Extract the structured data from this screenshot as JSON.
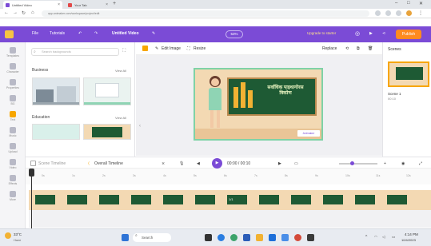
{
  "browser": {
    "tabs": [
      {
        "label": "Untitled Video",
        "active": true
      },
      {
        "label": "Your Tab",
        "active": false
      }
    ],
    "new_tab": "+",
    "url": "app.animaker.com/workspace/project/edit",
    "window_controls": [
      "–",
      "□",
      "✕"
    ]
  },
  "app": {
    "menu": [
      "File",
      "Tutorials"
    ],
    "project_title": "Untitled Video",
    "zoom": "53%",
    "upgrade": "Upgrade to starter",
    "publish": "Publish",
    "accent": "#7b4bd6",
    "publish_color": "#ff8a1f"
  },
  "rail": [
    {
      "label": "Templates",
      "icon": "template-icon",
      "selected": false
    },
    {
      "label": "Character",
      "icon": "character-icon",
      "selected": false
    },
    {
      "label": "Properties",
      "icon": "properties-icon",
      "selected": false
    },
    {
      "label": "BG",
      "icon": "background-icon",
      "selected": false
    },
    {
      "label": "Text",
      "icon": "text-icon",
      "selected": true
    },
    {
      "label": "Music",
      "icon": "music-icon",
      "selected": false
    },
    {
      "label": "Upload",
      "icon": "upload-icon",
      "selected": false
    },
    {
      "label": "Video",
      "icon": "video-icon",
      "selected": false
    },
    {
      "label": "Effects",
      "icon": "effects-icon",
      "selected": false
    },
    {
      "label": "More",
      "icon": "more-icon",
      "selected": false
    }
  ],
  "library": {
    "search_placeholder": "Search backgrounds",
    "categories": [
      {
        "title": "Business",
        "view_all": "View All"
      },
      {
        "title": "Education",
        "view_all": "View All"
      }
    ]
  },
  "canvas": {
    "edit_image": "Edit Image",
    "resize": "Resize",
    "replace": "Replace",
    "board_text": "सर्वाधिक पाइथागोरस त्रिकोण",
    "watermark": "Animaker"
  },
  "scenes": {
    "title": "Scenes",
    "scene_label": "Scene 1",
    "scene_time": "00:10"
  },
  "timeline": {
    "scene_timeline": "Scene Timeline",
    "overall_timeline": "Overall Timeline",
    "time_display": "00:00 / 00:10",
    "ticks": [
      "0s",
      "1s",
      "2s",
      "3s",
      "4s",
      "5s",
      "6s",
      "7s",
      "8s",
      "9s",
      "10s",
      "11s",
      "12s"
    ],
    "track_label": "1/1",
    "track_color": "#f3d9b3",
    "frame_color": "#1e5a34"
  },
  "taskbar": {
    "weather_temp": "33°C",
    "weather_desc": "Haze",
    "search": "Search",
    "time": "4:14 PM",
    "date": "10/4/2023"
  }
}
